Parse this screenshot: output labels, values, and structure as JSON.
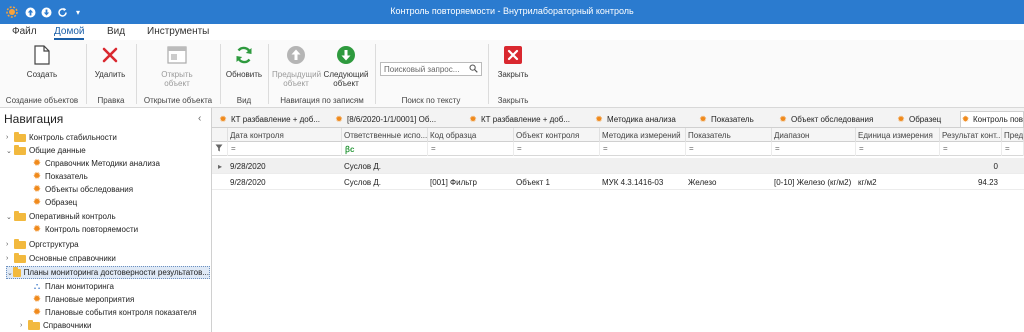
{
  "window": {
    "title": "Контроль повторяемости - Внутрилабораторный контроль",
    "quick_access": [
      "app-icon",
      "back-icon",
      "download-icon",
      "refresh-icon",
      "chevron-down-icon"
    ]
  },
  "menu": {
    "tabs": [
      "Файл",
      "Домой",
      "Вид",
      "Инструменты"
    ],
    "active": "Домой"
  },
  "ribbon": {
    "create": "Создать",
    "delete": "Удалить",
    "open_line1": "Открыть",
    "open_line2": "объект",
    "refresh": "Обновить",
    "prev_line1": "Предыдущий",
    "prev_line2": "объект",
    "next_line1": "Следующий",
    "next_line2": "объект",
    "search_placeholder": "Поисковый запрос...",
    "close": "Закрыть",
    "groups": {
      "create": "Создание объектов",
      "edit": "Правка",
      "open": "Открытие объекта",
      "view": "Вид",
      "navigation": "Навигация по записям",
      "search": "Поиск по тексту",
      "close": "Закрыть"
    }
  },
  "nav": {
    "title": "Навигация",
    "items": [
      {
        "label": "Контроль стабильности",
        "icon": "folder-icon",
        "arrow": "›"
      },
      {
        "label": "Общие данные",
        "icon": "folder-icon",
        "arrow": "⌄"
      },
      {
        "label": "Справочник Методики анализа",
        "icon": "gear-icon"
      },
      {
        "label": "Показатель",
        "icon": "gear-icon"
      },
      {
        "label": "Объекты обследования",
        "icon": "gear-icon"
      },
      {
        "label": "Образец",
        "icon": "gear-icon"
      },
      {
        "label": "Оперативный контроль",
        "icon": "folder-icon",
        "arrow": "⌄"
      },
      {
        "label": "Контроль повторяемости",
        "icon": "gear-icon"
      },
      {
        "label": "Оргструктура",
        "icon": "folder-icon",
        "arrow": "›"
      },
      {
        "label": "Основные справочники",
        "icon": "folder-icon",
        "arrow": "›"
      },
      {
        "label": "Планы мониторинга достоверности результатов...",
        "icon": "folder-icon",
        "arrow": "⌄"
      },
      {
        "label": "План мониторинга",
        "icon": "hierarchy-icon"
      },
      {
        "label": "Плановые мероприятия",
        "icon": "gear-icon"
      },
      {
        "label": "Плановые события контроля показателя",
        "icon": "gear-icon"
      },
      {
        "label": "Справочники",
        "icon": "folder-icon",
        "arrow": "›"
      }
    ]
  },
  "doc_tabs": [
    "КТ разбавление + доб...",
    "[8/6/2020-1/1/0001] Об...",
    "КТ разбавление + доб...",
    "Методика анализа",
    "Показатель",
    "Объект обследования",
    "Образец",
    "Контроль пов"
  ],
  "grid": {
    "columns": [
      "Дата контроля",
      "Ответственные испо...",
      "Код образца",
      "Объект контроля",
      "Методика измерений",
      "Показатель",
      "Диапазон",
      "Единица измерения",
      "Результат конт...",
      "Предел"
    ],
    "filter_marks": [
      "=",
      "ꞵc",
      "=",
      "=",
      "=",
      "=",
      "=",
      "=",
      "=",
      "="
    ],
    "rows": [
      {
        "type": "group",
        "cells": [
          "9/28/2020",
          "Суслов Д.",
          "",
          "",
          "",
          "",
          "",
          "",
          "0",
          ""
        ]
      },
      {
        "type": "data",
        "cells": [
          "9/28/2020",
          "Суслов Д.",
          "[001] Фильтр",
          "Объект 1",
          "МУК 4.3.1416-03",
          "Железо",
          "[0-10] Железо (кг/м2)",
          "кг/м2",
          "94.23",
          ""
        ]
      }
    ]
  },
  "colors": {
    "titlebar": "#2b7bcf",
    "accent": "#1a5fa8",
    "create_icon": "#444444",
    "delete_icon": "#d9282f",
    "refresh_icon": "#2e9a3e",
    "next_icon": "#2e9a3e",
    "close_icon": "#d9282f",
    "folder": "#f2b93e",
    "gear": "#f08a1c"
  }
}
